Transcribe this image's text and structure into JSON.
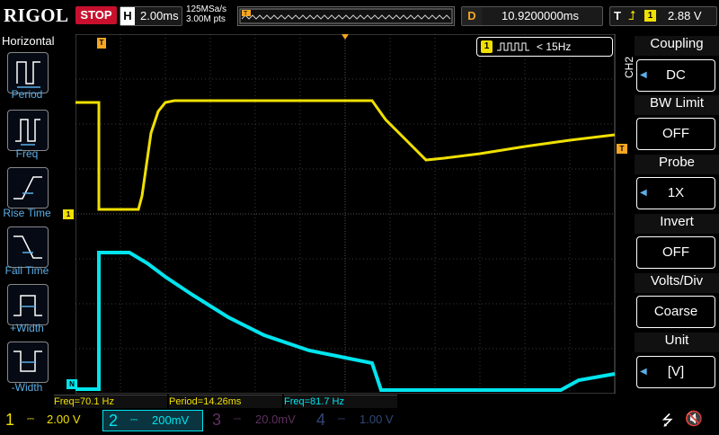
{
  "header": {
    "logo": "RIGOL",
    "run_state": "STOP",
    "horizontal_tag": "H",
    "timebase": "2.00ms",
    "sample_rate": "125MSa/s",
    "memory_depth": "3.00M pts",
    "delay_tag": "D",
    "delay": "10.9200000ms",
    "trigger_tag": "T",
    "trigger_channel": "1",
    "trigger_level": "2.88 V"
  },
  "left_menu": {
    "title": "Horizontal",
    "items": [
      {
        "label": "Period",
        "icon": "period-icon"
      },
      {
        "label": "Freq",
        "icon": "frequency-icon"
      },
      {
        "label": "Rise Time",
        "icon": "rise-time-icon"
      },
      {
        "label": "Fall Time",
        "icon": "fall-time-icon"
      },
      {
        "label": "+Width",
        "icon": "positive-width-icon"
      },
      {
        "label": "-Width",
        "icon": "negative-width-icon"
      }
    ]
  },
  "screen": {
    "freq_counter": "< 15Hz",
    "freq_counter_channel": "1",
    "ch1_marker": "1",
    "ch2_marker": "N",
    "trigger_marker": "T"
  },
  "right_menu": {
    "channel": "CH2",
    "items": [
      {
        "title": "Coupling",
        "value": "DC",
        "arrow": true
      },
      {
        "title": "BW Limit",
        "value": "OFF",
        "arrow": false
      },
      {
        "title": "Probe",
        "value": "1X",
        "arrow": true
      },
      {
        "title": "Invert",
        "value": "OFF",
        "arrow": false
      },
      {
        "title": "Volts/Div",
        "value": "Coarse",
        "arrow": false
      },
      {
        "title": "Unit",
        "value": "[V]",
        "arrow": true
      }
    ]
  },
  "measurements": [
    "Freq=70.1 Hz",
    "Period=14.26ms",
    "Freq=81.7 Hz"
  ],
  "channels": [
    {
      "number": "1",
      "scale": "2.00 V",
      "color": "#f0e000",
      "active": true
    },
    {
      "number": "2",
      "scale": "200mV",
      "color": "#00e5ee",
      "active": true
    },
    {
      "number": "3",
      "scale": "20.0mV",
      "color": "#c040c0",
      "active": false
    },
    {
      "number": "4",
      "scale": "1.00 V",
      "color": "#3060d0",
      "active": false
    }
  ],
  "colors": {
    "ch1": "#f0e000",
    "ch2": "#00e5ee",
    "stop": "#c8102e",
    "trigger": "#f5a623",
    "menu_accent": "#5aaee8"
  }
}
